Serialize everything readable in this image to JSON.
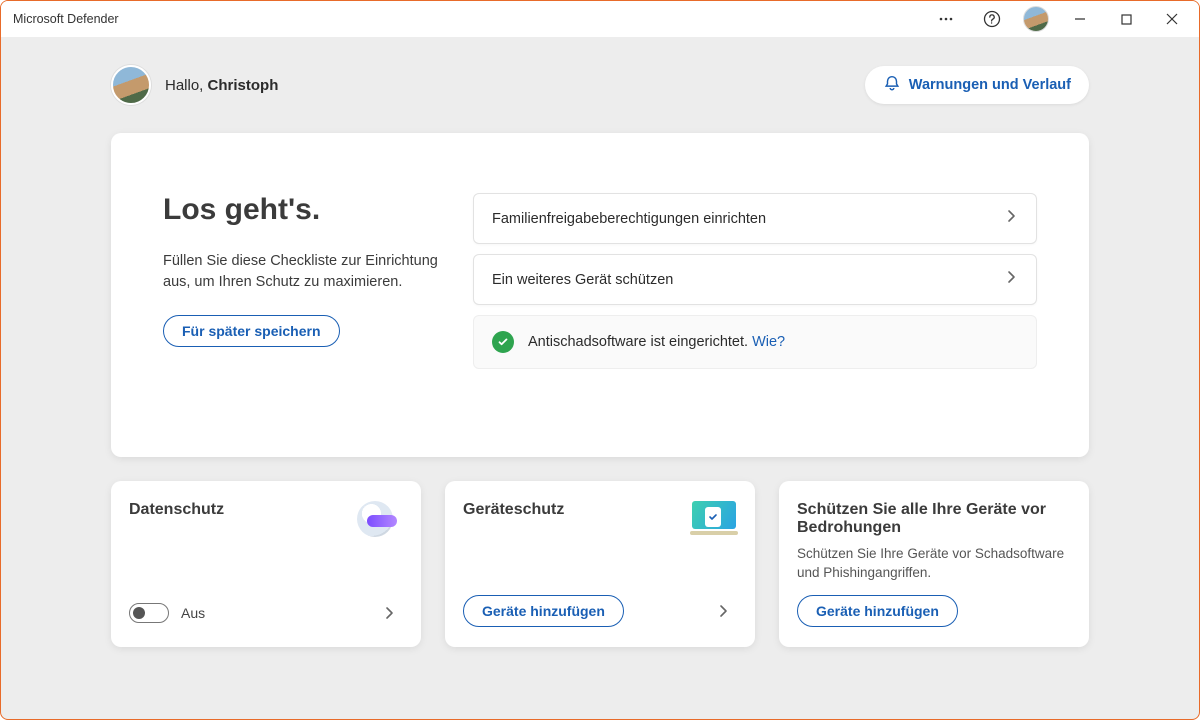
{
  "window": {
    "title": "Microsoft Defender"
  },
  "greeting": {
    "prefix": "Hallo, ",
    "name": "Christoph"
  },
  "alerts_button": "Warnungen und Verlauf",
  "intro": {
    "heading": "Los geht's.",
    "body": "Füllen Sie diese Checkliste zur Einrichtung aus, um Ihren Schutz zu maximieren.",
    "save_later": "Für später speichern"
  },
  "checklist": {
    "item1": "Familienfreigabeberechtigungen einrichten",
    "item2": "Ein weiteres Gerät schützen",
    "done_text": "Antischadsoftware ist eingerichtet. ",
    "done_link": "Wie?"
  },
  "cards": {
    "privacy": {
      "title": "Datenschutz",
      "toggle_state": "Aus"
    },
    "device": {
      "title": "Geräteschutz",
      "add_button": "Geräte hinzufügen"
    },
    "protect_all": {
      "title": "Schützen Sie alle Ihre Geräte vor Bedrohungen",
      "desc": "Schützen Sie Ihre Geräte vor Schadsoftware und Phishingangriffen.",
      "add_button": "Geräte hinzufügen"
    }
  }
}
